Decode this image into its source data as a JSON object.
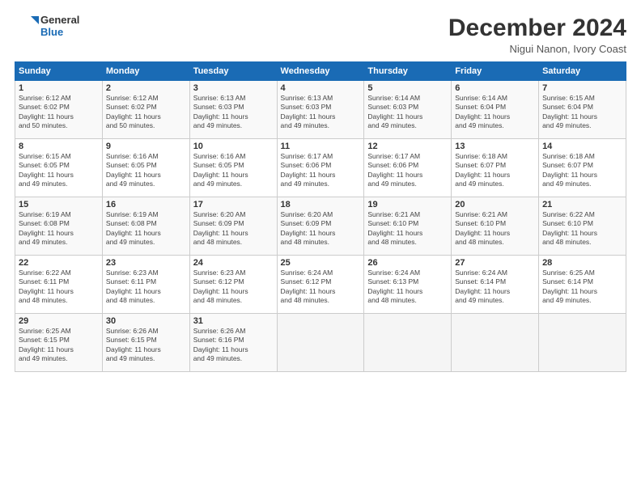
{
  "logo": {
    "line1": "General",
    "line2": "Blue"
  },
  "title": "December 2024",
  "subtitle": "Nigui Nanon, Ivory Coast",
  "weekdays": [
    "Sunday",
    "Monday",
    "Tuesday",
    "Wednesday",
    "Thursday",
    "Friday",
    "Saturday"
  ],
  "weeks": [
    [
      {
        "day": 1,
        "info": "Sunrise: 6:12 AM\nSunset: 6:02 PM\nDaylight: 11 hours\nand 50 minutes."
      },
      {
        "day": 2,
        "info": "Sunrise: 6:12 AM\nSunset: 6:02 PM\nDaylight: 11 hours\nand 50 minutes."
      },
      {
        "day": 3,
        "info": "Sunrise: 6:13 AM\nSunset: 6:03 PM\nDaylight: 11 hours\nand 49 minutes."
      },
      {
        "day": 4,
        "info": "Sunrise: 6:13 AM\nSunset: 6:03 PM\nDaylight: 11 hours\nand 49 minutes."
      },
      {
        "day": 5,
        "info": "Sunrise: 6:14 AM\nSunset: 6:03 PM\nDaylight: 11 hours\nand 49 minutes."
      },
      {
        "day": 6,
        "info": "Sunrise: 6:14 AM\nSunset: 6:04 PM\nDaylight: 11 hours\nand 49 minutes."
      },
      {
        "day": 7,
        "info": "Sunrise: 6:15 AM\nSunset: 6:04 PM\nDaylight: 11 hours\nand 49 minutes."
      }
    ],
    [
      {
        "day": 8,
        "info": "Sunrise: 6:15 AM\nSunset: 6:05 PM\nDaylight: 11 hours\nand 49 minutes."
      },
      {
        "day": 9,
        "info": "Sunrise: 6:16 AM\nSunset: 6:05 PM\nDaylight: 11 hours\nand 49 minutes."
      },
      {
        "day": 10,
        "info": "Sunrise: 6:16 AM\nSunset: 6:05 PM\nDaylight: 11 hours\nand 49 minutes."
      },
      {
        "day": 11,
        "info": "Sunrise: 6:17 AM\nSunset: 6:06 PM\nDaylight: 11 hours\nand 49 minutes."
      },
      {
        "day": 12,
        "info": "Sunrise: 6:17 AM\nSunset: 6:06 PM\nDaylight: 11 hours\nand 49 minutes."
      },
      {
        "day": 13,
        "info": "Sunrise: 6:18 AM\nSunset: 6:07 PM\nDaylight: 11 hours\nand 49 minutes."
      },
      {
        "day": 14,
        "info": "Sunrise: 6:18 AM\nSunset: 6:07 PM\nDaylight: 11 hours\nand 49 minutes."
      }
    ],
    [
      {
        "day": 15,
        "info": "Sunrise: 6:19 AM\nSunset: 6:08 PM\nDaylight: 11 hours\nand 49 minutes."
      },
      {
        "day": 16,
        "info": "Sunrise: 6:19 AM\nSunset: 6:08 PM\nDaylight: 11 hours\nand 49 minutes."
      },
      {
        "day": 17,
        "info": "Sunrise: 6:20 AM\nSunset: 6:09 PM\nDaylight: 11 hours\nand 48 minutes."
      },
      {
        "day": 18,
        "info": "Sunrise: 6:20 AM\nSunset: 6:09 PM\nDaylight: 11 hours\nand 48 minutes."
      },
      {
        "day": 19,
        "info": "Sunrise: 6:21 AM\nSunset: 6:10 PM\nDaylight: 11 hours\nand 48 minutes."
      },
      {
        "day": 20,
        "info": "Sunrise: 6:21 AM\nSunset: 6:10 PM\nDaylight: 11 hours\nand 48 minutes."
      },
      {
        "day": 21,
        "info": "Sunrise: 6:22 AM\nSunset: 6:10 PM\nDaylight: 11 hours\nand 48 minutes."
      }
    ],
    [
      {
        "day": 22,
        "info": "Sunrise: 6:22 AM\nSunset: 6:11 PM\nDaylight: 11 hours\nand 48 minutes."
      },
      {
        "day": 23,
        "info": "Sunrise: 6:23 AM\nSunset: 6:11 PM\nDaylight: 11 hours\nand 48 minutes."
      },
      {
        "day": 24,
        "info": "Sunrise: 6:23 AM\nSunset: 6:12 PM\nDaylight: 11 hours\nand 48 minutes."
      },
      {
        "day": 25,
        "info": "Sunrise: 6:24 AM\nSunset: 6:12 PM\nDaylight: 11 hours\nand 48 minutes."
      },
      {
        "day": 26,
        "info": "Sunrise: 6:24 AM\nSunset: 6:13 PM\nDaylight: 11 hours\nand 48 minutes."
      },
      {
        "day": 27,
        "info": "Sunrise: 6:24 AM\nSunset: 6:14 PM\nDaylight: 11 hours\nand 49 minutes."
      },
      {
        "day": 28,
        "info": "Sunrise: 6:25 AM\nSunset: 6:14 PM\nDaylight: 11 hours\nand 49 minutes."
      }
    ],
    [
      {
        "day": 29,
        "info": "Sunrise: 6:25 AM\nSunset: 6:15 PM\nDaylight: 11 hours\nand 49 minutes."
      },
      {
        "day": 30,
        "info": "Sunrise: 6:26 AM\nSunset: 6:15 PM\nDaylight: 11 hours\nand 49 minutes."
      },
      {
        "day": 31,
        "info": "Sunrise: 6:26 AM\nSunset: 6:16 PM\nDaylight: 11 hours\nand 49 minutes."
      },
      null,
      null,
      null,
      null
    ]
  ]
}
